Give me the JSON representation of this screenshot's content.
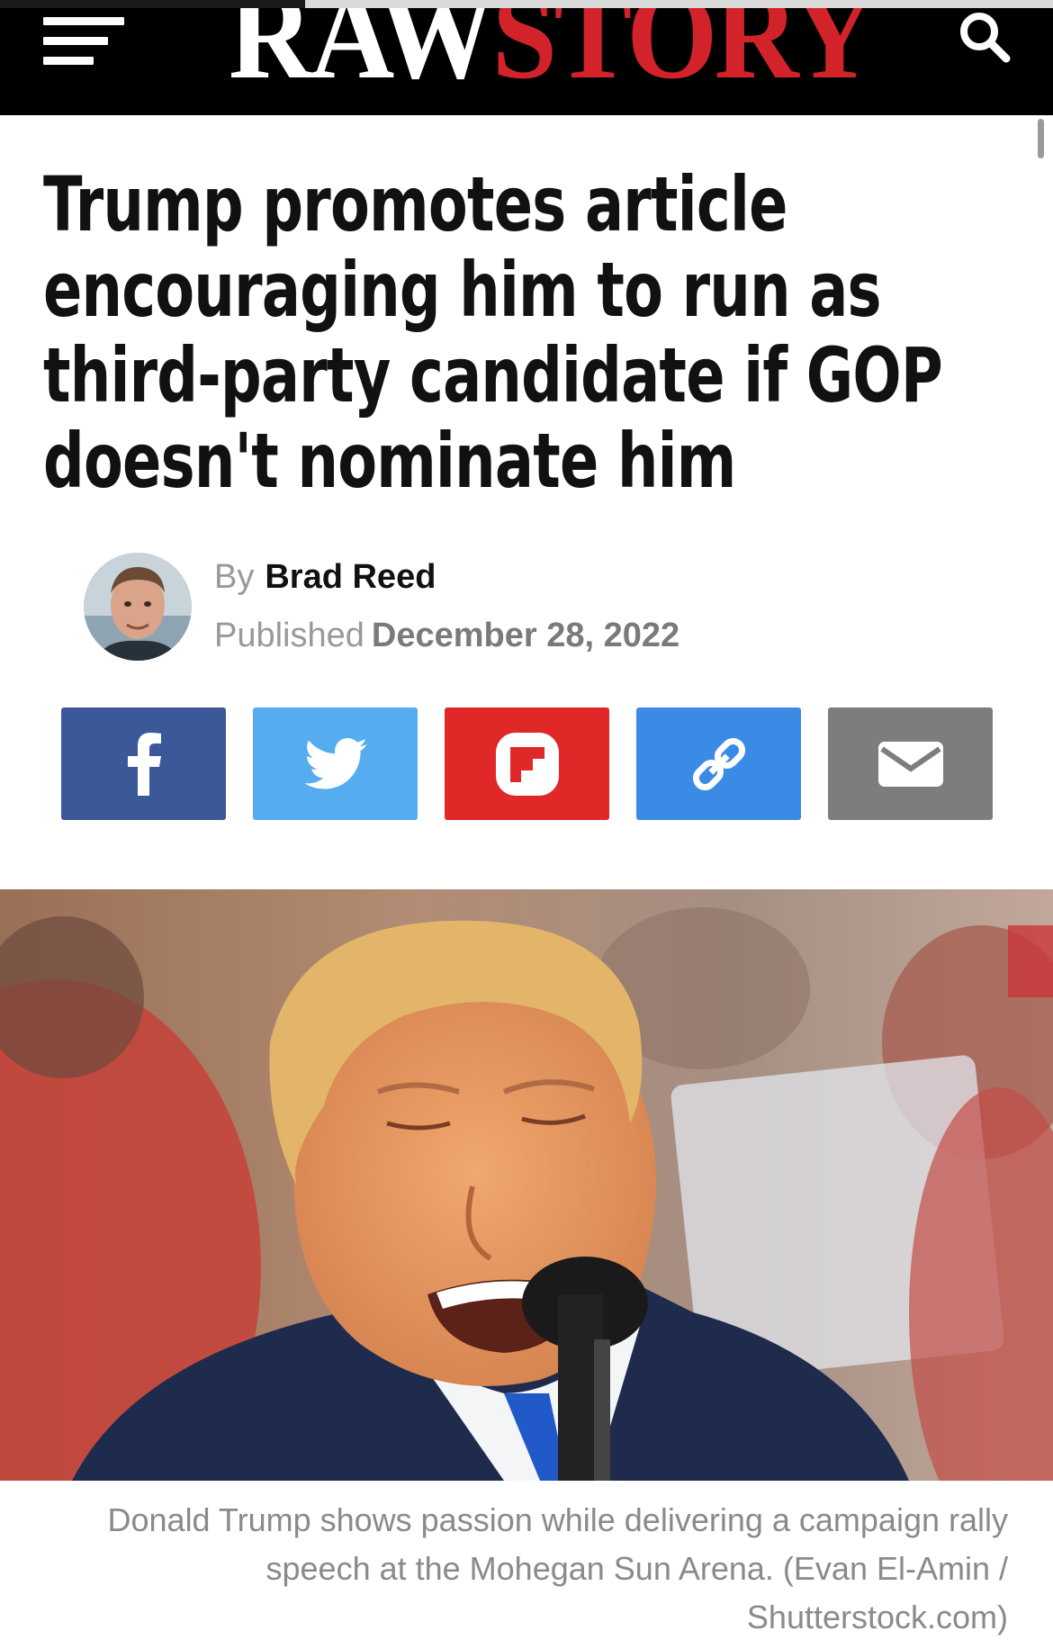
{
  "header": {
    "logo_raw": "RAW",
    "logo_story": "STORY",
    "menu_icon": "hamburger-menu-icon",
    "search_icon": "search-icon",
    "page_load_progress": 0.29
  },
  "article": {
    "headline": "Trump promotes article encouraging him to run as third-party candidate if GOP doesn't nominate him",
    "by_label": "By",
    "author": "Brad Reed",
    "published_label": "Published",
    "published_date": "December 28, 2022"
  },
  "share": [
    {
      "name": "facebook",
      "icon": "facebook-icon",
      "color": "#3b5998"
    },
    {
      "name": "twitter",
      "icon": "twitter-icon",
      "color": "#55acee"
    },
    {
      "name": "flipboard",
      "icon": "flipboard-icon",
      "color": "#e12828"
    },
    {
      "name": "copy-link",
      "icon": "link-icon",
      "color": "#3b8be6"
    },
    {
      "name": "email",
      "icon": "email-icon",
      "color": "#7d7d7d"
    }
  ],
  "hero": {
    "caption": "Donald Trump shows passion while delivering a campaign rally speech at the Mohegan Sun Arena. (Evan El-Amin / Shutterstock.com)"
  },
  "colors": {
    "header_bg": "#000000",
    "brand_red": "#d2232a"
  }
}
